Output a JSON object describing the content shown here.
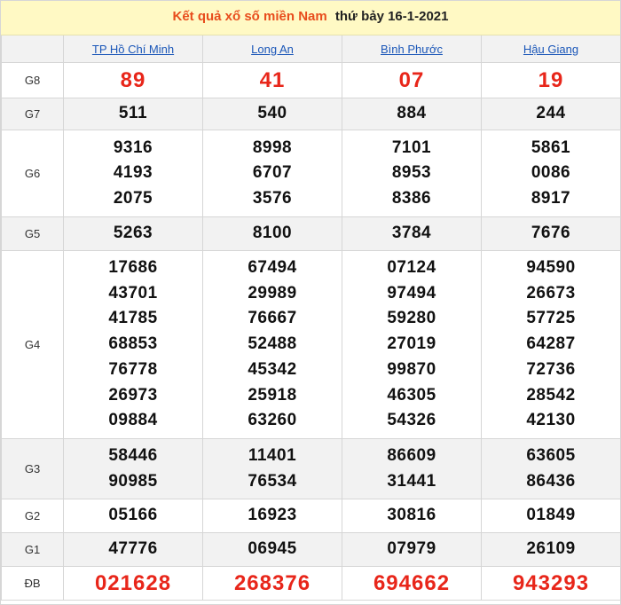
{
  "title": {
    "main": "Kết quả xổ số miền Nam",
    "date": "thứ bảy 16-1-2021"
  },
  "provinces": [
    "TP Hồ Chí Minh",
    "Long An",
    "Bình Phước",
    "Hậu Giang"
  ],
  "rows": [
    {
      "label": "G8",
      "values": [
        [
          "89"
        ],
        [
          "41"
        ],
        [
          "07"
        ],
        [
          "19"
        ]
      ]
    },
    {
      "label": "G7",
      "values": [
        [
          "511"
        ],
        [
          "540"
        ],
        [
          "884"
        ],
        [
          "244"
        ]
      ]
    },
    {
      "label": "G6",
      "values": [
        [
          "9316",
          "4193",
          "2075"
        ],
        [
          "8998",
          "6707",
          "3576"
        ],
        [
          "7101",
          "8953",
          "8386"
        ],
        [
          "5861",
          "0086",
          "8917"
        ]
      ]
    },
    {
      "label": "G5",
      "values": [
        [
          "5263"
        ],
        [
          "8100"
        ],
        [
          "3784"
        ],
        [
          "7676"
        ]
      ]
    },
    {
      "label": "G4",
      "values": [
        [
          "17686",
          "43701",
          "41785",
          "68853",
          "76778",
          "26973",
          "09884"
        ],
        [
          "67494",
          "29989",
          "76667",
          "52488",
          "45342",
          "25918",
          "63260"
        ],
        [
          "07124",
          "97494",
          "59280",
          "27019",
          "99870",
          "46305",
          "54326"
        ],
        [
          "94590",
          "26673",
          "57725",
          "64287",
          "72736",
          "28542",
          "42130"
        ]
      ]
    },
    {
      "label": "G3",
      "values": [
        [
          "58446",
          "90985"
        ],
        [
          "11401",
          "76534"
        ],
        [
          "86609",
          "31441"
        ],
        [
          "63605",
          "86436"
        ]
      ]
    },
    {
      "label": "G2",
      "values": [
        [
          "05166"
        ],
        [
          "16923"
        ],
        [
          "30816"
        ],
        [
          "01849"
        ]
      ]
    },
    {
      "label": "G1",
      "values": [
        [
          "47776"
        ],
        [
          "06945"
        ],
        [
          "07979"
        ],
        [
          "26109"
        ]
      ]
    },
    {
      "label": "ĐB",
      "values": [
        [
          "021628"
        ],
        [
          "268376"
        ],
        [
          "694662"
        ],
        [
          "943293"
        ]
      ]
    }
  ],
  "colors": {
    "title_accent": "#e84c1c",
    "highlight_number": "#e8261a",
    "link": "#1a56b8",
    "title_background": "#fff9c4",
    "shaded_row": "#f2f2f2"
  }
}
